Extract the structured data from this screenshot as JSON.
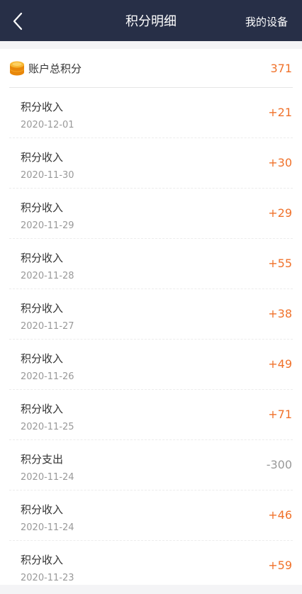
{
  "header": {
    "title": "积分明细",
    "right_label": "我的设备"
  },
  "total": {
    "label": "账户总积分",
    "value": "371"
  },
  "records": [
    {
      "title": "积分收入",
      "date": "2020-12-01",
      "amount": "+21",
      "kind": "income"
    },
    {
      "title": "积分收入",
      "date": "2020-11-30",
      "amount": "+30",
      "kind": "income"
    },
    {
      "title": "积分收入",
      "date": "2020-11-29",
      "amount": "+29",
      "kind": "income"
    },
    {
      "title": "积分收入",
      "date": "2020-11-28",
      "amount": "+55",
      "kind": "income"
    },
    {
      "title": "积分收入",
      "date": "2020-11-27",
      "amount": "+38",
      "kind": "income"
    },
    {
      "title": "积分收入",
      "date": "2020-11-26",
      "amount": "+49",
      "kind": "income"
    },
    {
      "title": "积分收入",
      "date": "2020-11-25",
      "amount": "+71",
      "kind": "income"
    },
    {
      "title": "积分支出",
      "date": "2020-11-24",
      "amount": "-300",
      "kind": "expense"
    },
    {
      "title": "积分收入",
      "date": "2020-11-24",
      "amount": "+46",
      "kind": "income"
    },
    {
      "title": "积分收入",
      "date": "2020-11-23",
      "amount": "+59",
      "kind": "income"
    }
  ],
  "colors": {
    "header_bg": "#272f47",
    "income": "#f0722b",
    "expense": "#999999"
  },
  "icons": {
    "back": "chevron-left-icon",
    "coin": "coin-stack-icon"
  }
}
